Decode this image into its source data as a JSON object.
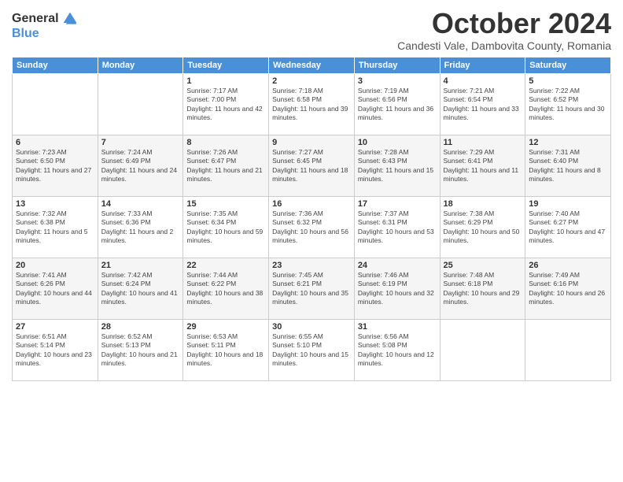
{
  "logo": {
    "general": "General",
    "blue": "Blue"
  },
  "header": {
    "title": "October 2024",
    "subtitle": "Candesti Vale, Dambovita County, Romania"
  },
  "weekdays": [
    "Sunday",
    "Monday",
    "Tuesday",
    "Wednesday",
    "Thursday",
    "Friday",
    "Saturday"
  ],
  "weeks": [
    [
      {
        "day": "",
        "info": ""
      },
      {
        "day": "",
        "info": ""
      },
      {
        "day": "1",
        "info": "Sunrise: 7:17 AM\nSunset: 7:00 PM\nDaylight: 11 hours and 42 minutes."
      },
      {
        "day": "2",
        "info": "Sunrise: 7:18 AM\nSunset: 6:58 PM\nDaylight: 11 hours and 39 minutes."
      },
      {
        "day": "3",
        "info": "Sunrise: 7:19 AM\nSunset: 6:56 PM\nDaylight: 11 hours and 36 minutes."
      },
      {
        "day": "4",
        "info": "Sunrise: 7:21 AM\nSunset: 6:54 PM\nDaylight: 11 hours and 33 minutes."
      },
      {
        "day": "5",
        "info": "Sunrise: 7:22 AM\nSunset: 6:52 PM\nDaylight: 11 hours and 30 minutes."
      }
    ],
    [
      {
        "day": "6",
        "info": "Sunrise: 7:23 AM\nSunset: 6:50 PM\nDaylight: 11 hours and 27 minutes."
      },
      {
        "day": "7",
        "info": "Sunrise: 7:24 AM\nSunset: 6:49 PM\nDaylight: 11 hours and 24 minutes."
      },
      {
        "day": "8",
        "info": "Sunrise: 7:26 AM\nSunset: 6:47 PM\nDaylight: 11 hours and 21 minutes."
      },
      {
        "day": "9",
        "info": "Sunrise: 7:27 AM\nSunset: 6:45 PM\nDaylight: 11 hours and 18 minutes."
      },
      {
        "day": "10",
        "info": "Sunrise: 7:28 AM\nSunset: 6:43 PM\nDaylight: 11 hours and 15 minutes."
      },
      {
        "day": "11",
        "info": "Sunrise: 7:29 AM\nSunset: 6:41 PM\nDaylight: 11 hours and 11 minutes."
      },
      {
        "day": "12",
        "info": "Sunrise: 7:31 AM\nSunset: 6:40 PM\nDaylight: 11 hours and 8 minutes."
      }
    ],
    [
      {
        "day": "13",
        "info": "Sunrise: 7:32 AM\nSunset: 6:38 PM\nDaylight: 11 hours and 5 minutes."
      },
      {
        "day": "14",
        "info": "Sunrise: 7:33 AM\nSunset: 6:36 PM\nDaylight: 11 hours and 2 minutes."
      },
      {
        "day": "15",
        "info": "Sunrise: 7:35 AM\nSunset: 6:34 PM\nDaylight: 10 hours and 59 minutes."
      },
      {
        "day": "16",
        "info": "Sunrise: 7:36 AM\nSunset: 6:32 PM\nDaylight: 10 hours and 56 minutes."
      },
      {
        "day": "17",
        "info": "Sunrise: 7:37 AM\nSunset: 6:31 PM\nDaylight: 10 hours and 53 minutes."
      },
      {
        "day": "18",
        "info": "Sunrise: 7:38 AM\nSunset: 6:29 PM\nDaylight: 10 hours and 50 minutes."
      },
      {
        "day": "19",
        "info": "Sunrise: 7:40 AM\nSunset: 6:27 PM\nDaylight: 10 hours and 47 minutes."
      }
    ],
    [
      {
        "day": "20",
        "info": "Sunrise: 7:41 AM\nSunset: 6:26 PM\nDaylight: 10 hours and 44 minutes."
      },
      {
        "day": "21",
        "info": "Sunrise: 7:42 AM\nSunset: 6:24 PM\nDaylight: 10 hours and 41 minutes."
      },
      {
        "day": "22",
        "info": "Sunrise: 7:44 AM\nSunset: 6:22 PM\nDaylight: 10 hours and 38 minutes."
      },
      {
        "day": "23",
        "info": "Sunrise: 7:45 AM\nSunset: 6:21 PM\nDaylight: 10 hours and 35 minutes."
      },
      {
        "day": "24",
        "info": "Sunrise: 7:46 AM\nSunset: 6:19 PM\nDaylight: 10 hours and 32 minutes."
      },
      {
        "day": "25",
        "info": "Sunrise: 7:48 AM\nSunset: 6:18 PM\nDaylight: 10 hours and 29 minutes."
      },
      {
        "day": "26",
        "info": "Sunrise: 7:49 AM\nSunset: 6:16 PM\nDaylight: 10 hours and 26 minutes."
      }
    ],
    [
      {
        "day": "27",
        "info": "Sunrise: 6:51 AM\nSunset: 5:14 PM\nDaylight: 10 hours and 23 minutes."
      },
      {
        "day": "28",
        "info": "Sunrise: 6:52 AM\nSunset: 5:13 PM\nDaylight: 10 hours and 21 minutes."
      },
      {
        "day": "29",
        "info": "Sunrise: 6:53 AM\nSunset: 5:11 PM\nDaylight: 10 hours and 18 minutes."
      },
      {
        "day": "30",
        "info": "Sunrise: 6:55 AM\nSunset: 5:10 PM\nDaylight: 10 hours and 15 minutes."
      },
      {
        "day": "31",
        "info": "Sunrise: 6:56 AM\nSunset: 5:08 PM\nDaylight: 10 hours and 12 minutes."
      },
      {
        "day": "",
        "info": ""
      },
      {
        "day": "",
        "info": ""
      }
    ]
  ]
}
